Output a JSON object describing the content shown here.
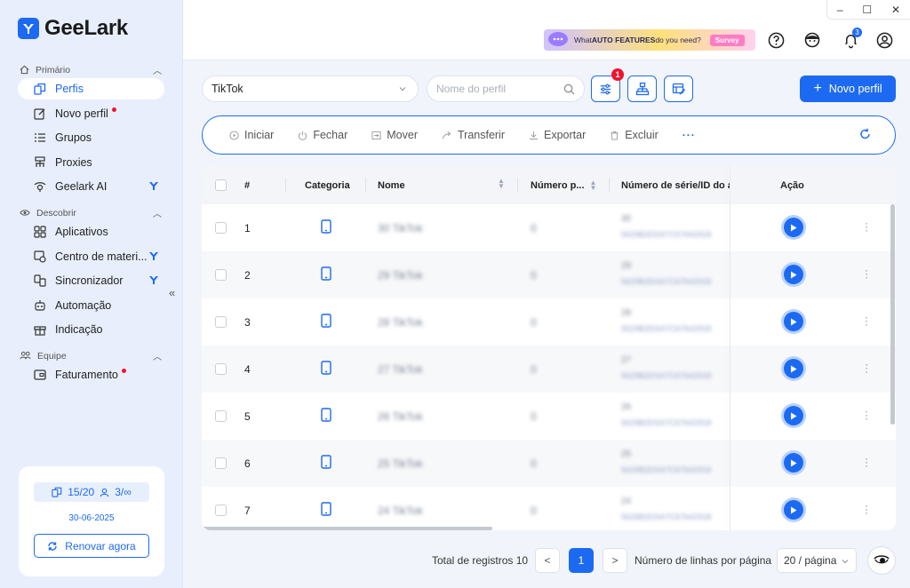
{
  "window": {
    "minimize": "–",
    "maximize": "☐",
    "close": "✕"
  },
  "brand": {
    "name": "GeeLark",
    "color": "#1d6af2"
  },
  "sidebar": {
    "sections": [
      {
        "label": "Primário",
        "icon": "home-icon"
      },
      {
        "label": "Descobrir",
        "icon": "eye-icon"
      },
      {
        "label": "Equipe",
        "icon": "team-icon"
      }
    ],
    "items": [
      {
        "label": "Perfis",
        "icon": "profiles-icon",
        "active": true
      },
      {
        "label": "Novo perfil",
        "icon": "edit-icon",
        "dot": true
      },
      {
        "label": "Grupos",
        "icon": "list-icon"
      },
      {
        "label": "Proxies",
        "icon": "proxy-icon"
      },
      {
        "label": "Geelark AI",
        "icon": "ai-icon",
        "bird": true
      },
      {
        "label": "Aplicativos",
        "icon": "apps-icon"
      },
      {
        "label": "Centro de materi...",
        "icon": "material-icon",
        "bird": true
      },
      {
        "label": "Sincronizador",
        "icon": "sync-icon",
        "bird": true
      },
      {
        "label": "Automação",
        "icon": "robot-icon"
      },
      {
        "label": "Indicação",
        "icon": "gift-icon"
      },
      {
        "label": "Faturamento",
        "icon": "wallet-icon",
        "dot": true
      }
    ],
    "collapse": "«"
  },
  "plan": {
    "profiles": "15/20",
    "members": "3/∞",
    "date": "30-06-2025",
    "renew": "Renovar agora"
  },
  "topbar": {
    "promo_text_pre": "What ",
    "promo_text_bold": "AUTO FEATURES",
    "promo_text_post": " do you need?",
    "promo_button": "Survey",
    "notification_count": "3"
  },
  "filters": {
    "platform": "TikTok",
    "search_placeholder": "Nome do perfil",
    "filter_badge": "1",
    "new_profile": "Novo perfil"
  },
  "actions": [
    {
      "label": "Iniciar",
      "icon": "play-outline-icon"
    },
    {
      "label": "Fechar",
      "icon": "power-icon"
    },
    {
      "label": "Mover",
      "icon": "move-icon"
    },
    {
      "label": "Transferir",
      "icon": "share-icon"
    },
    {
      "label": "Exportar",
      "icon": "download-icon"
    },
    {
      "label": "Excluir",
      "icon": "trash-icon"
    }
  ],
  "more": "···",
  "table": {
    "columns": [
      "#",
      "Categoria",
      "Nome",
      "Número p...",
      "Número de série/ID do ar",
      "Ação"
    ],
    "rows": [
      {
        "index": "1",
        "name": "30 TikTok",
        "num": "0",
        "serial_top": "30",
        "serial_bottom": "5629B2DSA7C67642918"
      },
      {
        "index": "2",
        "name": "29 TikTok",
        "num": "0",
        "serial_top": "29",
        "serial_bottom": "5629B2DSA7C67642918"
      },
      {
        "index": "3",
        "name": "28 TikTok",
        "num": "0",
        "serial_top": "28",
        "serial_bottom": "5629B2DSA7C67642918"
      },
      {
        "index": "4",
        "name": "27 TikTok",
        "num": "0",
        "serial_top": "27",
        "serial_bottom": "5629B2DSA7C67642918"
      },
      {
        "index": "5",
        "name": "26 TikTok",
        "num": "0",
        "serial_top": "26",
        "serial_bottom": "5629B2DSA7C67642918"
      },
      {
        "index": "6",
        "name": "25 TikTok",
        "num": "0",
        "serial_top": "25",
        "serial_bottom": "5629B2DSA7C67642918"
      },
      {
        "index": "7",
        "name": "24 TikTok",
        "num": "0",
        "serial_top": "24",
        "serial_bottom": "5629B2DSA7C67642918"
      }
    ]
  },
  "pagination": {
    "total": "Total de registros 10",
    "prev": "<",
    "current": "1",
    "next": ">",
    "rows_label": "Número de linhas por página",
    "page_size": "20 / página"
  }
}
